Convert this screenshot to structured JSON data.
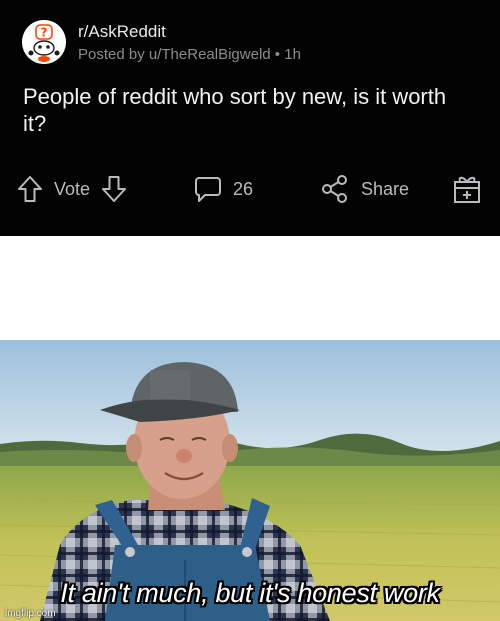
{
  "post": {
    "subreddit": "r/AskReddit",
    "posted_by": "Posted by u/TheRealBigweld",
    "separator": "•",
    "age": "1h",
    "title": "People of reddit who sort by new, is it worth it?",
    "actions": {
      "vote_label": "Vote",
      "comment_count": "26",
      "share_label": "Share"
    },
    "icons": [
      "upvote-arrow-icon",
      "downvote-arrow-icon",
      "comment-bubble-icon",
      "share-icon",
      "award-gift-icon"
    ]
  },
  "meme": {
    "caption": "It ain't much, but it's honest work",
    "watermark": "imgflip.com",
    "colors": {
      "sky": "#b7d3e6",
      "field": "#b7b848",
      "shirt": "#2a3a5c",
      "overalls": "#2e5f88"
    }
  },
  "colors": {
    "card_background": "#030303",
    "text_primary": "#f1f2f3",
    "text_muted": "#8a8c8e",
    "action_text": "#b9bcbe"
  }
}
